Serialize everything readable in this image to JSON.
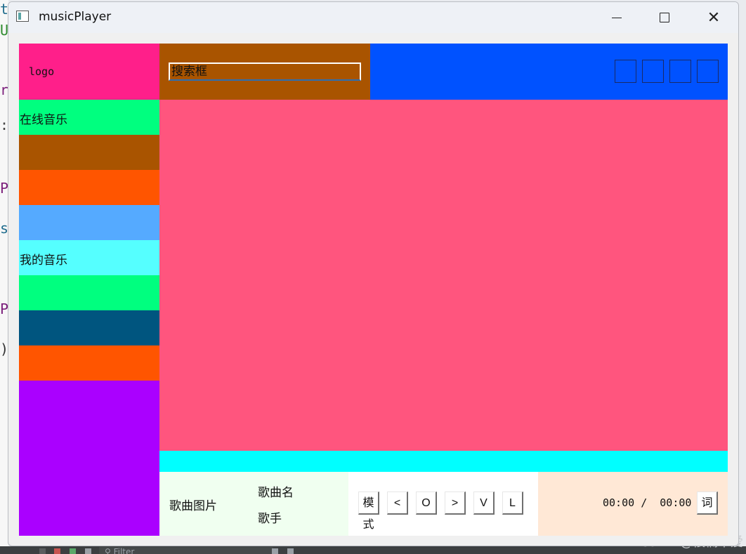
{
  "window": {
    "title": "musicPlayer"
  },
  "ide": {
    "filter_label": "Filter",
    "gutter_chars": [
      "t",
      "U",
      "r",
      ":",
      "P",
      "s",
      "P",
      ")"
    ]
  },
  "watermark": "CSDN @很楠不爱",
  "header": {
    "logo_text": "logo",
    "search_placeholder": "搜索框",
    "top_buttons": [
      "",
      "",
      "",
      ""
    ]
  },
  "sidebar": {
    "items": [
      {
        "label": "在线音乐",
        "color": "#00ff7f"
      },
      {
        "label": "",
        "color": "#a95400"
      },
      {
        "label": "",
        "color": "#ff5500"
      },
      {
        "label": "",
        "color": "#55aaff"
      },
      {
        "label": "我的音乐",
        "color": "#55ffff"
      },
      {
        "label": "",
        "color": "#00ff7f"
      },
      {
        "label": "",
        "color": "#00557f"
      },
      {
        "label": "",
        "color": "#ff5500"
      }
    ]
  },
  "footer": {
    "song_image_label": "歌曲图片",
    "song_name": "歌曲名",
    "artist": "歌手",
    "controls": {
      "mode": "模式",
      "prev": "<",
      "play": "O",
      "next": ">",
      "volume": "V",
      "list": "L"
    },
    "current_time": "00:00",
    "separator": "/",
    "total_time": "00:00",
    "lyrics_button": "词"
  },
  "colors": {
    "logo_bg": "#ff1f8a",
    "search_bg": "#a95400",
    "topbar_bg": "#0052ff",
    "main_bg": "#ff557e",
    "strip_bg": "#00ffff",
    "sidebar_bottom_bg": "#aa00ff",
    "song_info_bg": "#f0fff0",
    "time_bg": "#ffe8d6"
  }
}
